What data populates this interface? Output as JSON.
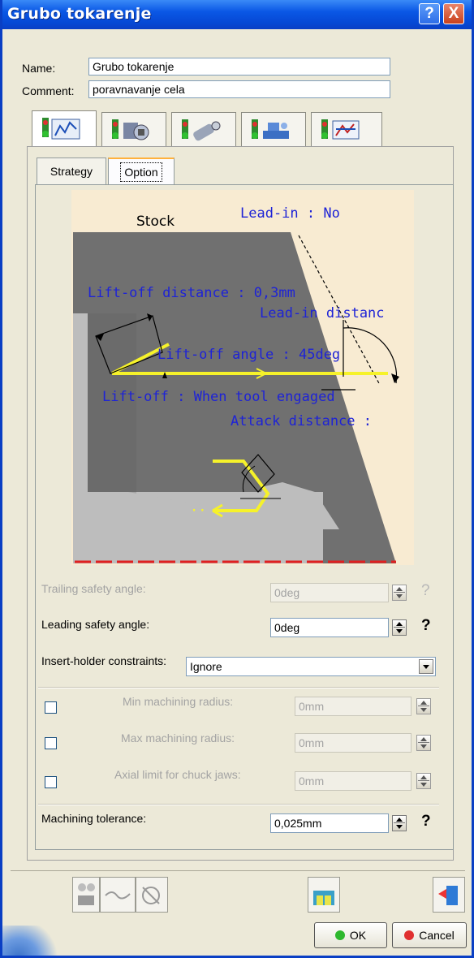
{
  "window": {
    "title": "Grubo tokarenje"
  },
  "form": {
    "name_label": "Name:",
    "name_value": "Grubo tokarenje",
    "comment_label": "Comment:",
    "comment_value": "poravnavanje cela"
  },
  "main_tabs": [
    "tab-geometry",
    "tab-tool",
    "tab-tool-assembly",
    "tab-feeds-speeds",
    "tab-macros"
  ],
  "sub_tabs": [
    {
      "label": "Strategy",
      "active": false
    },
    {
      "label": "Option",
      "active": true
    }
  ],
  "diagram": {
    "stock": "Stock",
    "lead_in": "Lead-in : No",
    "lift_off_distance": "Lift-off distance : 0,3mm",
    "lead_in_distance": "Lead-in distanc",
    "lift_off_angle": "Lift-off angle : 45deg",
    "lift_off_when": "Lift-off : When tool engaged",
    "attack_distance": "Attack distance :"
  },
  "options": {
    "trailing_safety_angle_label": "Trailing safety angle:",
    "trailing_safety_angle_value": "0deg",
    "leading_safety_angle_label": "Leading safety angle:",
    "leading_safety_angle_value": "0deg",
    "insert_holder_label": "Insert-holder constraints:",
    "insert_holder_value": "Ignore",
    "min_radius_label": "Min machining radius:",
    "min_radius_value": "0mm",
    "max_radius_label": "Max machining radius:",
    "max_radius_value": "0mm",
    "axial_limit_label": "Axial limit for chuck jaws:",
    "axial_limit_value": "0mm",
    "tolerance_label": "Machining tolerance:",
    "tolerance_value": "0,025mm",
    "help": "?"
  },
  "buttons": {
    "ok": "OK",
    "cancel": "Cancel",
    "help": "?",
    "close": "X"
  },
  "colors": {
    "title_blue": "#0a57e5",
    "diagram_text": "#1e23d6",
    "toolpath": "#f6f22a"
  }
}
